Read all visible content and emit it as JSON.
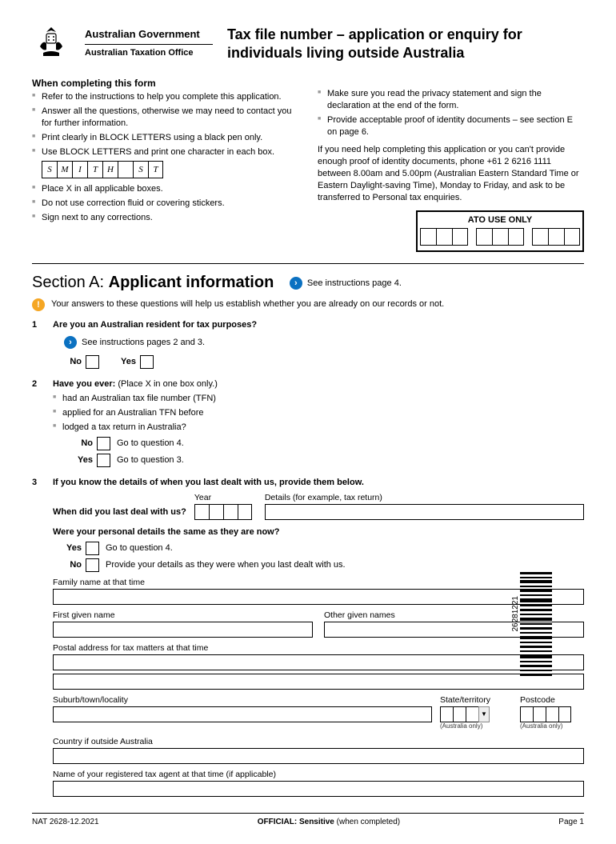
{
  "header": {
    "gov": "Australian Government",
    "agency": "Australian Taxation Office",
    "title": "Tax file number – application or enquiry for individuals living outside Australia"
  },
  "instructions": {
    "heading": "When completing this form",
    "left": [
      "Refer to the instructions to help you complete this application.",
      "Answer all the questions, otherwise we may need to contact you for further information.",
      "Print clearly in BLOCK LETTERS using a black pen only.",
      "Use BLOCK LETTERS and print one character in each box."
    ],
    "example_chars": [
      "S",
      "M",
      "I",
      "T",
      "H",
      "",
      "S",
      "T"
    ],
    "left2": [
      "Place X in all applicable boxes.",
      "Do not use correction fluid or covering stickers.",
      "Sign next to any corrections."
    ],
    "right": [
      "Make sure you read the privacy statement and sign the declaration at the end of the form.",
      "Provide acceptable proof of identity documents – see section E on page 6."
    ],
    "help_text": "If you need help completing this application or you can't provide enough proof of identity documents, phone +61 2 6216 1111 between 8.00am and 5.00pm (Australian Eastern Standard Time or Eastern Daylight-saving Time), Monday to Friday, and ask to be transferred to Personal tax enquiries.",
    "ato_box": "ATO USE ONLY"
  },
  "sectionA": {
    "label_prefix": "Section A: ",
    "label_main": "Applicant information",
    "see": "See instructions page 4.",
    "intro": "Your answers to these questions will help us establish whether you are already on our records or not.",
    "barcode_num": "26281221"
  },
  "q1": {
    "num": "1",
    "title": "Are you an Australian resident for tax purposes?",
    "see": "See instructions pages 2 and 3.",
    "no": "No",
    "yes": "Yes"
  },
  "q2": {
    "num": "2",
    "title_a": "Have you ever: ",
    "title_b": "(Place X in one box only.)",
    "items": [
      "had an Australian tax file number (TFN)",
      "applied for an Australian TFN before",
      "lodged a tax return in Australia?"
    ],
    "no": "No",
    "no_hint": "Go to question 4.",
    "yes": "Yes",
    "yes_hint": "Go to question 3."
  },
  "q3": {
    "num": "3",
    "title": "If you know the details of when you last dealt with us, provide them below.",
    "when_label": "When did you last deal with us?",
    "year_label": "Year",
    "details_label": "Details (for example, tax return)",
    "same_q": "Were your personal details the same as they are now?",
    "yes": "Yes",
    "yes_hint": "Go to question 4.",
    "no": "No",
    "no_hint": "Provide your details as they were when you last dealt with us.",
    "family": "Family name at that time",
    "first": "First given name",
    "other": "Other given names",
    "postal": "Postal address for tax matters at that time",
    "suburb": "Suburb/town/locality",
    "state": "State/territory",
    "postcode": "Postcode",
    "aus_only": "(Australia only)",
    "country": "Country if outside Australia",
    "agent": "Name of your registered tax agent at that time (if applicable)"
  },
  "footer": {
    "left": "NAT 2628-12.2021",
    "center_bold": "OFFICIAL: Sensitive",
    "center_rest": " (when completed)",
    "right": "Page 1"
  }
}
